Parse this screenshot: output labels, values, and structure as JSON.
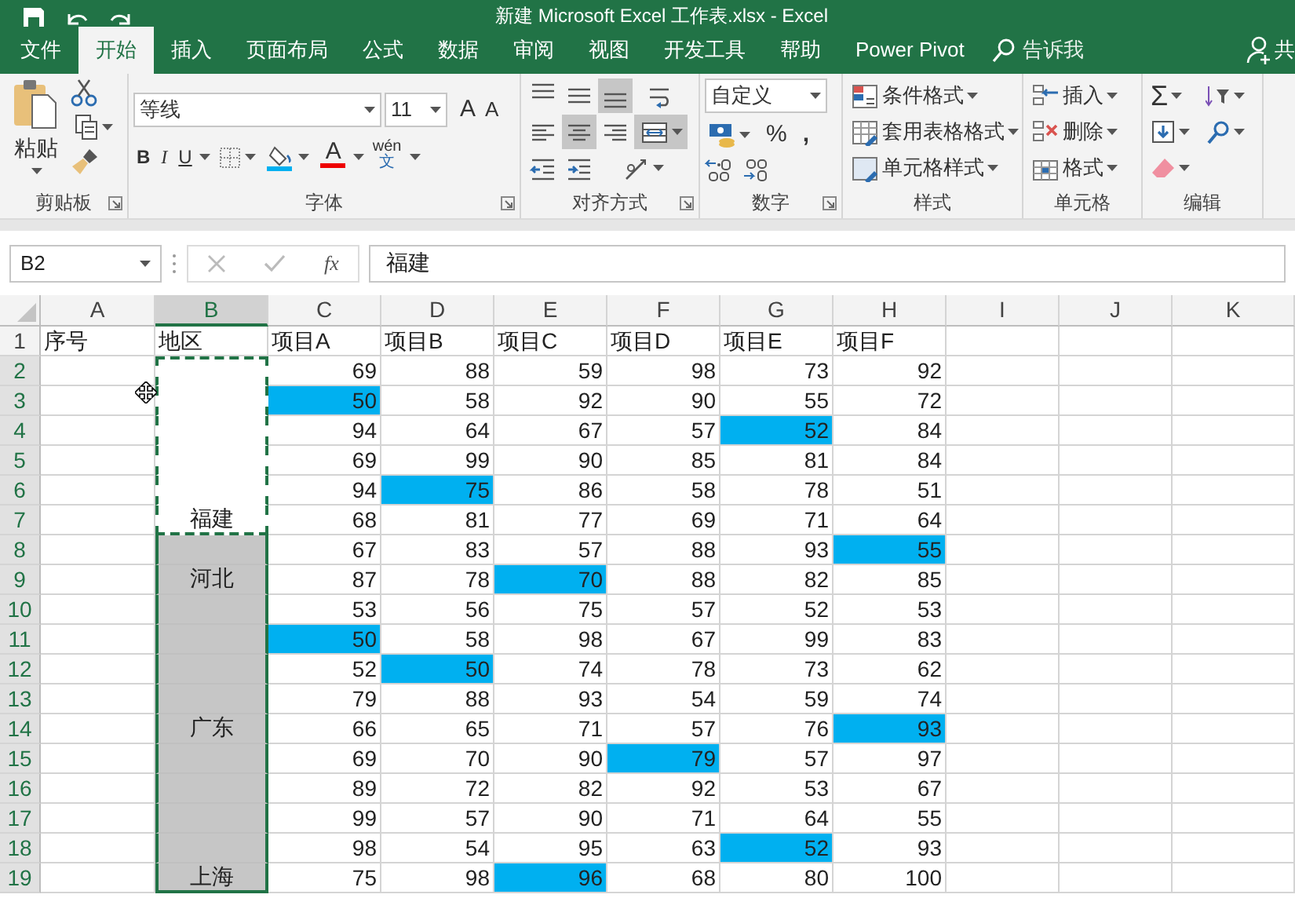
{
  "window": {
    "title": "新建 Microsoft Excel 工作表.xlsx - Excel"
  },
  "tabs": [
    {
      "label": "文件",
      "selected": false
    },
    {
      "label": "开始",
      "selected": true
    },
    {
      "label": "插入",
      "selected": false
    },
    {
      "label": "页面布局",
      "selected": false
    },
    {
      "label": "公式",
      "selected": false
    },
    {
      "label": "数据",
      "selected": false
    },
    {
      "label": "审阅",
      "selected": false
    },
    {
      "label": "视图",
      "selected": false
    },
    {
      "label": "开发工具",
      "selected": false
    },
    {
      "label": "帮助",
      "selected": false
    },
    {
      "label": "Power Pivot",
      "selected": false
    }
  ],
  "tell_me": {
    "label": "告诉我"
  },
  "share": {
    "label": "共"
  },
  "ribbon": {
    "groups": [
      {
        "kind": "clipboard",
        "name": "剪贴板",
        "paste_label": "粘贴"
      },
      {
        "kind": "font",
        "name": "字体",
        "font_name": "等线",
        "font_size": "11",
        "grow": "A",
        "shrink": "A",
        "bold": "B",
        "italic": "I",
        "underline": "U",
        "font_color": "A",
        "phonetic_top": "wén",
        "phonetic_bottom": "文"
      },
      {
        "kind": "alignment",
        "name": "对齐方式",
        "buttons": [
          {
            "kind": "align-top",
            "selected": false
          },
          {
            "kind": "align-middle",
            "selected": false
          },
          {
            "kind": "align-bottom",
            "selected": true
          },
          {
            "kind": "wrap",
            "selected": false
          },
          {
            "kind": "align-left",
            "selected": false
          },
          {
            "kind": "align-center",
            "selected": true
          },
          {
            "kind": "align-right",
            "selected": false
          },
          {
            "kind": "merge",
            "selected": true
          },
          {
            "kind": "outdent",
            "selected": false
          },
          {
            "kind": "indent",
            "selected": false
          },
          {
            "kind": "orientation",
            "selected": false
          }
        ]
      },
      {
        "kind": "number",
        "name": "数字",
        "format": "自定义",
        "percent": "%",
        "comma": ","
      },
      {
        "kind": "styles",
        "name": "样式",
        "items": [
          {
            "kind": "conditional",
            "label": "条件格式"
          },
          {
            "kind": "table",
            "label": "套用表格格式"
          },
          {
            "kind": "cellstyle",
            "label": "单元格样式"
          }
        ]
      },
      {
        "kind": "cells",
        "name": "单元格",
        "items": [
          {
            "kind": "insert",
            "label": "插入"
          },
          {
            "kind": "delete",
            "label": "删除"
          },
          {
            "kind": "format",
            "label": "格式"
          }
        ]
      },
      {
        "kind": "editing",
        "name": "编辑",
        "sum": "Σ"
      }
    ]
  },
  "formula_bar": {
    "name_box": "B2",
    "function_label": "fx",
    "content": "福建"
  },
  "sheet": {
    "columns": [
      {
        "label": "A",
        "selected": false
      },
      {
        "label": "B",
        "selected": true
      },
      {
        "label": "C",
        "selected": false
      },
      {
        "label": "D",
        "selected": false
      },
      {
        "label": "E",
        "selected": false
      },
      {
        "label": "F",
        "selected": false
      },
      {
        "label": "G",
        "selected": false
      },
      {
        "label": "H",
        "selected": false
      },
      {
        "label": "I",
        "selected": false
      },
      {
        "label": "J",
        "selected": false
      },
      {
        "label": "K",
        "selected": false
      }
    ],
    "rows": [
      {
        "header": "1",
        "selected": false,
        "copied": false,
        "cells": [
          "序号",
          "地区",
          "项目A",
          "项目B",
          "项目C",
          "项目D",
          "项目E",
          "项目F",
          "",
          "",
          ""
        ],
        "highlighted": [
          false,
          false,
          false,
          false,
          false,
          false,
          false,
          false,
          false,
          false,
          false
        ]
      },
      {
        "header": "2",
        "selected": true,
        "copied": true,
        "cells": [
          "",
          "",
          "69",
          "88",
          "59",
          "98",
          "73",
          "92",
          "",
          "",
          ""
        ],
        "highlighted": [
          false,
          false,
          false,
          false,
          false,
          false,
          false,
          false,
          false,
          false,
          false
        ]
      },
      {
        "header": "3",
        "selected": true,
        "copied": true,
        "cells": [
          "",
          "",
          "50",
          "58",
          "92",
          "90",
          "55",
          "72",
          "",
          "",
          ""
        ],
        "highlighted": [
          false,
          false,
          true,
          false,
          false,
          false,
          false,
          false,
          false,
          false,
          false
        ]
      },
      {
        "header": "4",
        "selected": true,
        "copied": true,
        "cells": [
          "",
          "",
          "94",
          "64",
          "67",
          "57",
          "52",
          "84",
          "",
          "",
          ""
        ],
        "highlighted": [
          false,
          false,
          false,
          false,
          false,
          false,
          true,
          false,
          false,
          false,
          false
        ]
      },
      {
        "header": "5",
        "selected": true,
        "copied": true,
        "cells": [
          "",
          "",
          "69",
          "99",
          "90",
          "85",
          "81",
          "84",
          "",
          "",
          ""
        ],
        "highlighted": [
          false,
          false,
          false,
          false,
          false,
          false,
          false,
          false,
          false,
          false,
          false
        ]
      },
      {
        "header": "6",
        "selected": true,
        "copied": true,
        "cells": [
          "",
          "",
          "94",
          "75",
          "86",
          "58",
          "78",
          "51",
          "",
          "",
          ""
        ],
        "highlighted": [
          false,
          false,
          false,
          true,
          false,
          false,
          false,
          false,
          false,
          false,
          false
        ]
      },
      {
        "header": "7",
        "selected": true,
        "copied": true,
        "cells": [
          "",
          "福建",
          "68",
          "81",
          "77",
          "69",
          "71",
          "64",
          "",
          "",
          ""
        ],
        "highlighted": [
          false,
          false,
          false,
          false,
          false,
          false,
          false,
          false,
          false,
          false,
          false
        ]
      },
      {
        "header": "8",
        "selected": true,
        "copied": false,
        "cells": [
          "",
          "",
          "67",
          "83",
          "57",
          "88",
          "93",
          "55",
          "",
          "",
          ""
        ],
        "highlighted": [
          false,
          false,
          false,
          false,
          false,
          false,
          false,
          true,
          false,
          false,
          false
        ]
      },
      {
        "header": "9",
        "selected": true,
        "copied": false,
        "cells": [
          "",
          "河北",
          "87",
          "78",
          "70",
          "88",
          "82",
          "85",
          "",
          "",
          ""
        ],
        "highlighted": [
          false,
          false,
          false,
          false,
          true,
          false,
          false,
          false,
          false,
          false,
          false
        ]
      },
      {
        "header": "10",
        "selected": true,
        "copied": false,
        "cells": [
          "",
          "",
          "53",
          "56",
          "75",
          "57",
          "52",
          "53",
          "",
          "",
          ""
        ],
        "highlighted": [
          false,
          false,
          false,
          false,
          false,
          false,
          false,
          false,
          false,
          false,
          false
        ]
      },
      {
        "header": "11",
        "selected": true,
        "copied": false,
        "cells": [
          "",
          "",
          "50",
          "58",
          "98",
          "67",
          "99",
          "83",
          "",
          "",
          ""
        ],
        "highlighted": [
          false,
          false,
          true,
          false,
          false,
          false,
          false,
          false,
          false,
          false,
          false
        ]
      },
      {
        "header": "12",
        "selected": true,
        "copied": false,
        "cells": [
          "",
          "",
          "52",
          "50",
          "74",
          "78",
          "73",
          "62",
          "",
          "",
          ""
        ],
        "highlighted": [
          false,
          false,
          false,
          true,
          false,
          false,
          false,
          false,
          false,
          false,
          false
        ]
      },
      {
        "header": "13",
        "selected": true,
        "copied": false,
        "cells": [
          "",
          "",
          "79",
          "88",
          "93",
          "54",
          "59",
          "74",
          "",
          "",
          ""
        ],
        "highlighted": [
          false,
          false,
          false,
          false,
          false,
          false,
          false,
          false,
          false,
          false,
          false
        ]
      },
      {
        "header": "14",
        "selected": true,
        "copied": false,
        "cells": [
          "",
          "广东",
          "66",
          "65",
          "71",
          "57",
          "76",
          "93",
          "",
          "",
          ""
        ],
        "highlighted": [
          false,
          false,
          false,
          false,
          false,
          false,
          false,
          true,
          false,
          false,
          false
        ]
      },
      {
        "header": "15",
        "selected": true,
        "copied": false,
        "cells": [
          "",
          "",
          "69",
          "70",
          "90",
          "79",
          "57",
          "97",
          "",
          "",
          ""
        ],
        "highlighted": [
          false,
          false,
          false,
          false,
          false,
          true,
          false,
          false,
          false,
          false,
          false
        ]
      },
      {
        "header": "16",
        "selected": true,
        "copied": false,
        "cells": [
          "",
          "",
          "89",
          "72",
          "82",
          "92",
          "53",
          "67",
          "",
          "",
          ""
        ],
        "highlighted": [
          false,
          false,
          false,
          false,
          false,
          false,
          false,
          false,
          false,
          false,
          false
        ]
      },
      {
        "header": "17",
        "selected": true,
        "copied": false,
        "cells": [
          "",
          "",
          "99",
          "57",
          "90",
          "71",
          "64",
          "55",
          "",
          "",
          ""
        ],
        "highlighted": [
          false,
          false,
          false,
          false,
          false,
          false,
          false,
          false,
          false,
          false,
          false
        ]
      },
      {
        "header": "18",
        "selected": true,
        "copied": false,
        "cells": [
          "",
          "",
          "98",
          "54",
          "95",
          "63",
          "52",
          "93",
          "",
          "",
          ""
        ],
        "highlighted": [
          false,
          false,
          false,
          false,
          false,
          false,
          true,
          false,
          false,
          false,
          false
        ]
      },
      {
        "header": "19",
        "selected": true,
        "copied": false,
        "cells": [
          "",
          "上海",
          "75",
          "98",
          "96",
          "68",
          "80",
          "100",
          "",
          "",
          ""
        ],
        "highlighted": [
          false,
          false,
          false,
          false,
          true,
          false,
          false,
          false,
          false,
          false,
          false
        ]
      }
    ]
  }
}
